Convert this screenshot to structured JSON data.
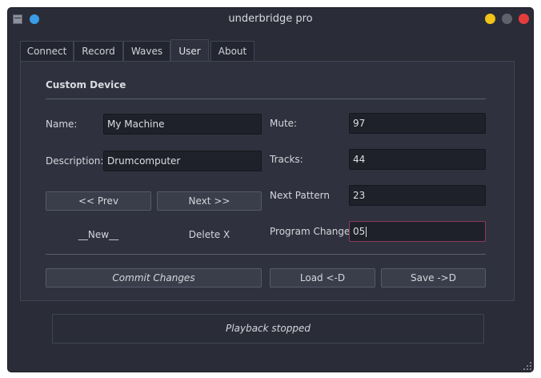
{
  "window": {
    "title": "underbridge pro"
  },
  "tabs": [
    {
      "label": "Connect",
      "active": false
    },
    {
      "label": "Record",
      "active": false
    },
    {
      "label": "Waves",
      "active": false
    },
    {
      "label": "User",
      "active": true
    },
    {
      "label": "About",
      "active": false
    }
  ],
  "custom_device": {
    "section_title": "Custom Device",
    "name_label": "Name:",
    "name_value": "My Machine",
    "description_label": "Description:",
    "description_value": "Drumcomputer",
    "prev_label": "<< Prev",
    "next_label": "Next >>",
    "new_label": "__New__",
    "delete_label": "Delete X",
    "mute_label": "Mute:",
    "mute_value": "97",
    "tracks_label": "Tracks:",
    "tracks_value": "44",
    "next_pattern_label": "Next Pattern",
    "next_pattern_value": "23",
    "program_change_label": "Program Change:",
    "program_change_value": "05",
    "commit_label": "Commit Changes",
    "load_label": "Load <-D",
    "save_label": "Save ->D"
  },
  "status": {
    "text": "Playback stopped"
  },
  "colors": {
    "accent_focus": "#8e3a5a",
    "pin": "#3a9de6",
    "minimize": "#f2c318",
    "close": "#e53c3c"
  }
}
